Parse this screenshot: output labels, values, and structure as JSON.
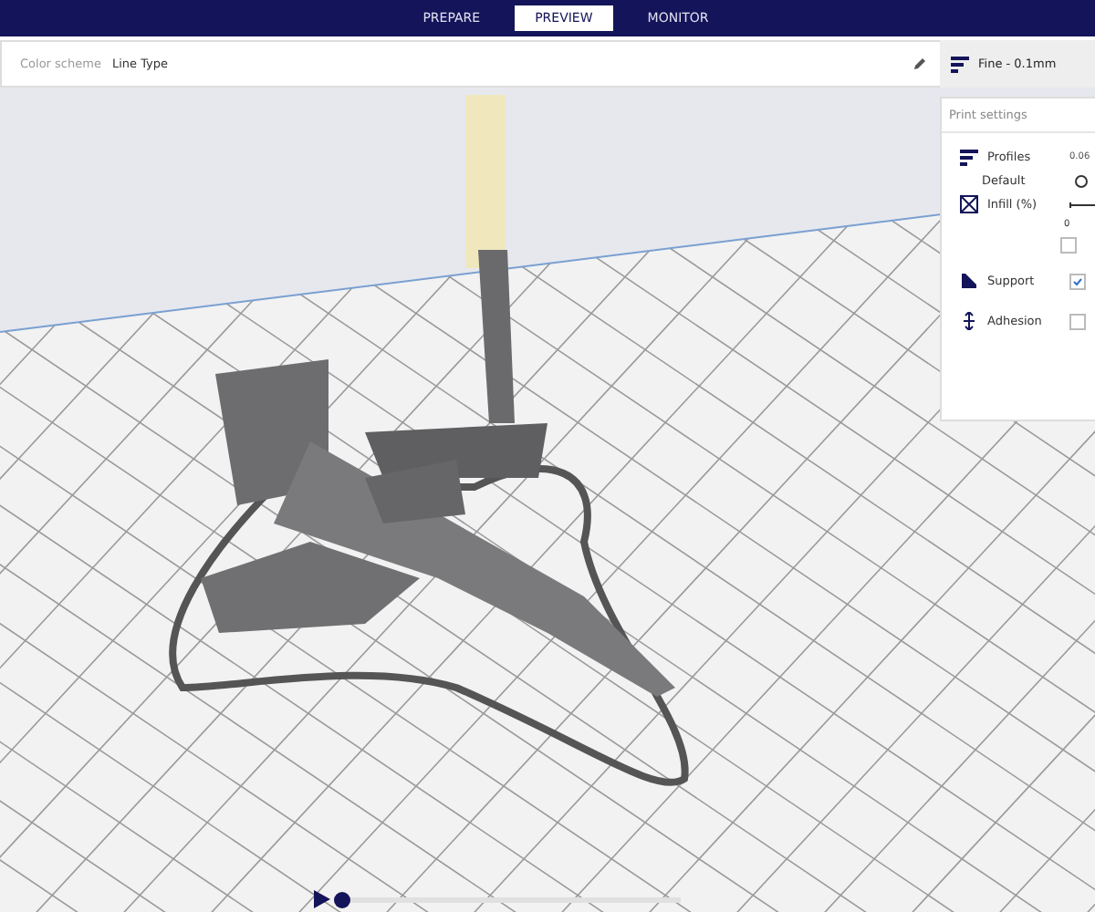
{
  "header": {
    "tabs": [
      {
        "label": "PREPARE",
        "selected": false
      },
      {
        "label": "PREVIEW",
        "selected": true
      },
      {
        "label": "MONITOR",
        "selected": false
      }
    ]
  },
  "view_bar": {
    "label": "Color scheme",
    "value": "Line Type"
  },
  "profile_button": {
    "label": "Fine - 0.1mm"
  },
  "print_settings": {
    "title": "Print settings",
    "profiles": {
      "label": "Profiles",
      "sub": "Default",
      "value": "0.06"
    },
    "infill": {
      "label": "Infill (%)",
      "tick": "0",
      "level": 0,
      "gradual": {
        "checked": false
      }
    },
    "support": {
      "label": "Support",
      "checked": true
    },
    "adhesion": {
      "label": "Adhesion",
      "checked": false
    }
  },
  "layer_slider": {
    "level": 0
  }
}
